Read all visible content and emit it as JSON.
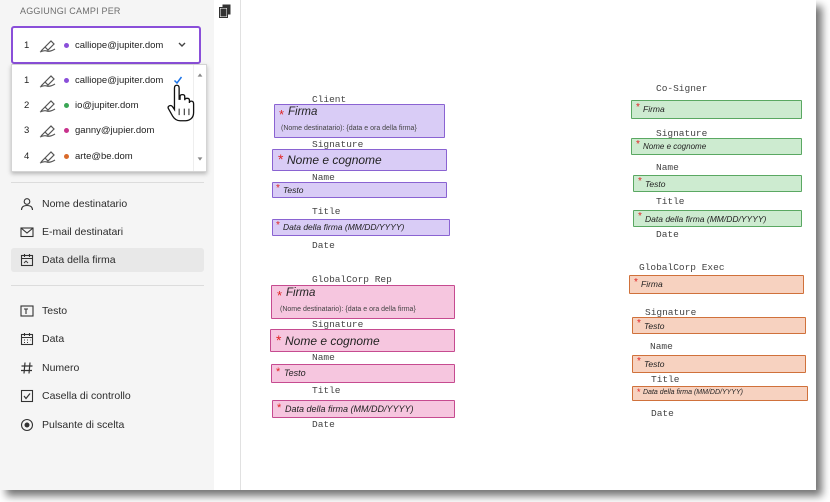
{
  "sidebar": {
    "title": "AGGIUNGI CAMPI PER",
    "selected": {
      "num": "1",
      "email": "calliope@jupiter.dom",
      "color": "#8a4fd9"
    },
    "recipients": [
      {
        "num": "1",
        "email": "calliope@jupiter.dom",
        "color": "#8a4fd9"
      },
      {
        "num": "2",
        "email": "io@jupiter.dom",
        "color": "#3aa655"
      },
      {
        "num": "3",
        "email": "ganny@jupier.dom",
        "color": "#c8328c"
      },
      {
        "num": "4",
        "email": "arte@be.dom",
        "color": "#d96a2b"
      }
    ],
    "menu1": [
      "Nome destinatario",
      "E-mail destinatari",
      "Data della firma"
    ],
    "menu2": [
      "Testo",
      "Data",
      "Numero",
      "Casella di controllo",
      "Pulsante di scelta"
    ]
  },
  "doc": {
    "client": {
      "heading": "Client",
      "firma": "Firma",
      "firma_sub": "(Nome destinatario): {data e ora della firma}",
      "signature": "Signature",
      "nome": "Nome e cognome",
      "name": "Name",
      "testo": "Testo",
      "title": "Title",
      "data": "Data della firma (MM/DD/YYYY)",
      "date": "Date"
    },
    "globalcorp_rep": {
      "heading": "GlobalCorp Rep",
      "firma": "Firma",
      "firma_sub": "(Nome destinatario): {data e ora della firma}",
      "signature": "Signature",
      "nome": "Nome e cognome",
      "name": "Name",
      "testo": "Testo",
      "title": "Title",
      "data": "Data della firma (MM/DD/YYYY)",
      "date": "Date"
    },
    "cosigner": {
      "heading": "Co-Signer",
      "firma": "Firma",
      "signature": "Signature",
      "nome": "Nome e cognome",
      "name": "Name",
      "testo": "Testo",
      "title": "Title",
      "data": "Data della firma (MM/DD/YYYY)",
      "date": "Date"
    },
    "globalcorp_exec": {
      "heading": "GlobalCorp Exec",
      "firma": "Firma",
      "signature": "Signature",
      "nome": "Testo",
      "name": "Name",
      "testo": "Testo",
      "title": "Title",
      "data": "Data della firma (MM/DD/YYYY)",
      "date": "Date"
    }
  },
  "colors": {
    "purple": "#8a63d2",
    "pink": "#c64b90",
    "green": "#5aa862",
    "orange": "#d0713b",
    "required": "#e02424"
  }
}
